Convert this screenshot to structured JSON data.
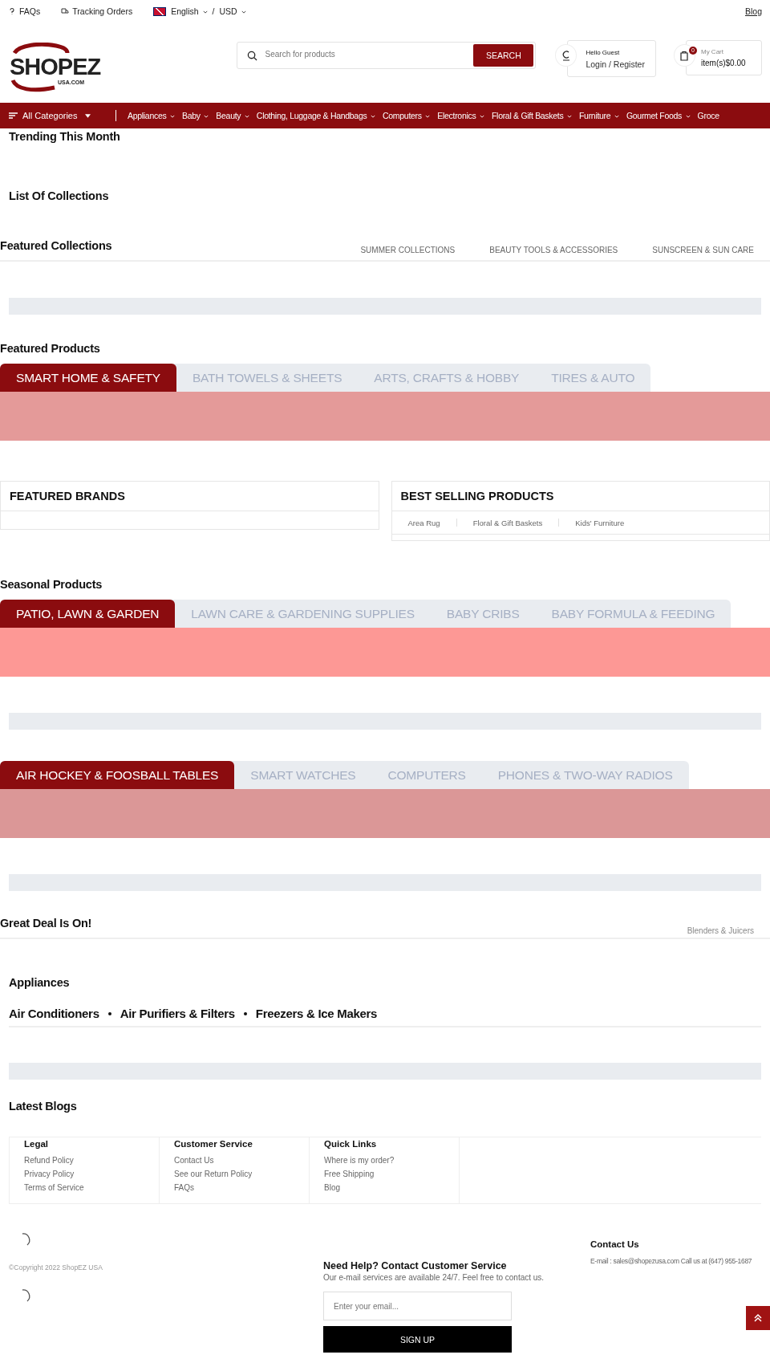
{
  "top_bar": {
    "links": [
      {
        "kind": "faq",
        "label": "FAQs"
      },
      {
        "kind": "tracking",
        "label": "Tracking Orders"
      }
    ],
    "language": "English",
    "separator": "/",
    "currency": "USD",
    "blog": "Blog"
  },
  "header": {
    "logo": {
      "name": "SHOPEZ",
      "sub": "USA.COM"
    },
    "search": {
      "placeholder": "Search for products",
      "button": "SEARCH"
    },
    "account": {
      "greeting": "Hello Guest",
      "login": "Login",
      "separator": "/",
      "register": "Register"
    },
    "cart": {
      "count": "0",
      "title": "My Cart",
      "items": "item(s)",
      "total": "$0.00"
    }
  },
  "nav": {
    "all_categories": "All Categories",
    "items": [
      "Appliances",
      "Baby",
      "Beauty",
      "Clothing, Luggage & Handbags",
      "Computers",
      "Electronics",
      "Floral & Gift Baskets",
      "Furniture",
      "Gourmet Foods"
    ],
    "cut_item": "Groce"
  },
  "trending": {
    "title": "Trending This Month"
  },
  "collections": {
    "title": "List Of Collections"
  },
  "featured_collections": {
    "title": "Featured Collections",
    "tabs": [
      "SUMMER COLLECTIONS",
      "BEAUTY TOOLS & ACCESSORIES",
      "SUNSCREEN & SUN CARE"
    ]
  },
  "featured_products": {
    "title": "Featured Products",
    "tabs": [
      {
        "label": "SMART HOME & SAFETY",
        "selected": true
      },
      {
        "label": "BATH TOWELS & SHEETS",
        "selected": false
      },
      {
        "label": "ARTS, CRAFTS & HOBBY",
        "selected": false
      },
      {
        "label": "TIRES & AUTO",
        "selected": false
      }
    ],
    "color": "#e49a99"
  },
  "featured_brands": {
    "title": "FEATURED BRANDS"
  },
  "best_selling": {
    "title": "BEST SELLING PRODUCTS",
    "tabs": [
      "Area Rug",
      "Floral & Gift Baskets",
      "Kids' Furniture"
    ]
  },
  "seasonal_products": {
    "title": "Seasonal Products",
    "tabs": [
      {
        "label": "PATIO, LAWN & GARDEN",
        "selected": true
      },
      {
        "label": "LAWN CARE & GARDENING SUPPLIES",
        "selected": false
      },
      {
        "label": "BABY CRIBS",
        "selected": false
      },
      {
        "label": "BABY FORMULA & FEEDING",
        "selected": false
      }
    ],
    "color": "#fd9895"
  },
  "more_products": {
    "tabs": [
      {
        "label": "AIR HOCKEY & FOOSBALL TABLES",
        "selected": true
      },
      {
        "label": "SMART WATCHES",
        "selected": false
      },
      {
        "label": "COMPUTERS",
        "selected": false
      },
      {
        "label": "PHONES & TWO-WAY RADIOS",
        "selected": false
      }
    ],
    "color": "#db9797"
  },
  "great_deal": {
    "title": "Great Deal Is On!",
    "tabs": [
      "Blenders & Juicers"
    ]
  },
  "appliances": {
    "title": "Appliances",
    "links": [
      "Air Conditioners",
      "Air Purifiers & Filters",
      "Freezers & Ice Makers"
    ]
  },
  "latest_blogs": {
    "title": "Latest Blogs"
  },
  "footer": {
    "columns": [
      {
        "title": "Legal",
        "links": [
          "Refund Policy",
          "Privacy Policy",
          "Terms of Service"
        ]
      },
      {
        "title": "Customer Service",
        "links": [
          "Contact Us",
          "See our Return Policy",
          "FAQs"
        ]
      },
      {
        "title": "Quick Links",
        "links": [
          "Where is my order?",
          "Free Shipping",
          "Blog"
        ]
      }
    ],
    "copyright": "©Copyright 2022 ShopEZ USA",
    "newsletter": {
      "title": "Need Help? Contact Customer Service",
      "text": "Our e-mail services are available 24/7. Feel free to contact us.",
      "placeholder": "Enter your email...",
      "button": "SIGN UP"
    },
    "contact": {
      "title": "Contact Us",
      "text": "E-mail : sales@shopezusa.com Call us at (647) 955-1687"
    }
  }
}
